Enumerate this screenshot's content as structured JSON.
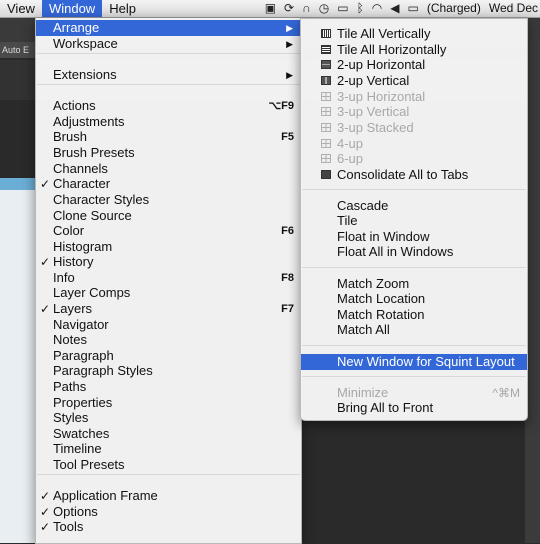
{
  "menubar": {
    "items": [
      "View",
      "Window",
      "Help"
    ],
    "active_index": 1,
    "status": {
      "icons": [
        "adobe-updater-icon",
        "sync-icon",
        "headphones-icon",
        "time-machine-icon",
        "display-icon",
        "bluetooth-icon",
        "wifi-icon",
        "volume-icon",
        "battery-icon"
      ],
      "battery_text": "(Charged)",
      "clock": "Wed Dec"
    }
  },
  "app": {
    "toolbar_label": "Auto E"
  },
  "window_menu": {
    "items": [
      {
        "label": "Arrange",
        "submenu": true,
        "highlighted": true
      },
      {
        "label": "Workspace",
        "submenu": true
      },
      {
        "label": "Extensions",
        "submenu": true
      },
      {
        "label": "Actions",
        "shortcut": "⌥F9"
      },
      {
        "label": "Adjustments"
      },
      {
        "label": "Brush",
        "shortcut": "F5"
      },
      {
        "label": "Brush Presets"
      },
      {
        "label": "Channels"
      },
      {
        "label": "Character",
        "checked": true
      },
      {
        "label": "Character Styles"
      },
      {
        "label": "Clone Source"
      },
      {
        "label": "Color",
        "shortcut": "F6"
      },
      {
        "label": "Histogram"
      },
      {
        "label": "History",
        "checked": true
      },
      {
        "label": "Info",
        "shortcut": "F8"
      },
      {
        "label": "Layer Comps"
      },
      {
        "label": "Layers",
        "checked": true,
        "shortcut": "F7"
      },
      {
        "label": "Navigator"
      },
      {
        "label": "Notes"
      },
      {
        "label": "Paragraph"
      },
      {
        "label": "Paragraph Styles"
      },
      {
        "label": "Paths"
      },
      {
        "label": "Properties"
      },
      {
        "label": "Styles"
      },
      {
        "label": "Swatches"
      },
      {
        "label": "Timeline"
      },
      {
        "label": "Tool Presets"
      },
      {
        "label": "Application Frame",
        "checked": true
      },
      {
        "label": "Options",
        "checked": true
      },
      {
        "label": "Tools",
        "checked": true
      }
    ]
  },
  "arrange_menu": {
    "items": [
      {
        "label": "Tile All Vertically",
        "icon": "tile-vertical-icon"
      },
      {
        "label": "Tile All Horizontally",
        "icon": "tile-horizontal-icon"
      },
      {
        "label": "2-up Horizontal",
        "icon": "two-up-horizontal-icon"
      },
      {
        "label": "2-up Vertical",
        "icon": "two-up-vertical-icon"
      },
      {
        "label": "3-up Horizontal",
        "icon": "three-up-horizontal-icon",
        "disabled": true
      },
      {
        "label": "3-up Vertical",
        "icon": "three-up-vertical-icon",
        "disabled": true
      },
      {
        "label": "3-up Stacked",
        "icon": "three-up-stacked-icon",
        "disabled": true
      },
      {
        "label": "4-up",
        "icon": "four-up-icon",
        "disabled": true
      },
      {
        "label": "6-up",
        "icon": "six-up-icon",
        "disabled": true
      },
      {
        "label": "Consolidate All to Tabs",
        "icon": "consolidate-tabs-icon"
      },
      {
        "label": "Cascade"
      },
      {
        "label": "Tile"
      },
      {
        "label": "Float in Window"
      },
      {
        "label": "Float All in Windows"
      },
      {
        "label": "Match Zoom"
      },
      {
        "label": "Match Location"
      },
      {
        "label": "Match Rotation"
      },
      {
        "label": "Match All"
      },
      {
        "label": "New Window for Squint Layout",
        "highlighted": true
      },
      {
        "label": "Minimize",
        "disabled": true,
        "shortcut": "^⌘M"
      },
      {
        "label": "Bring All to Front"
      }
    ]
  },
  "colors": {
    "highlight": "#3366d6",
    "disabled_text": "#a8a8a8"
  }
}
